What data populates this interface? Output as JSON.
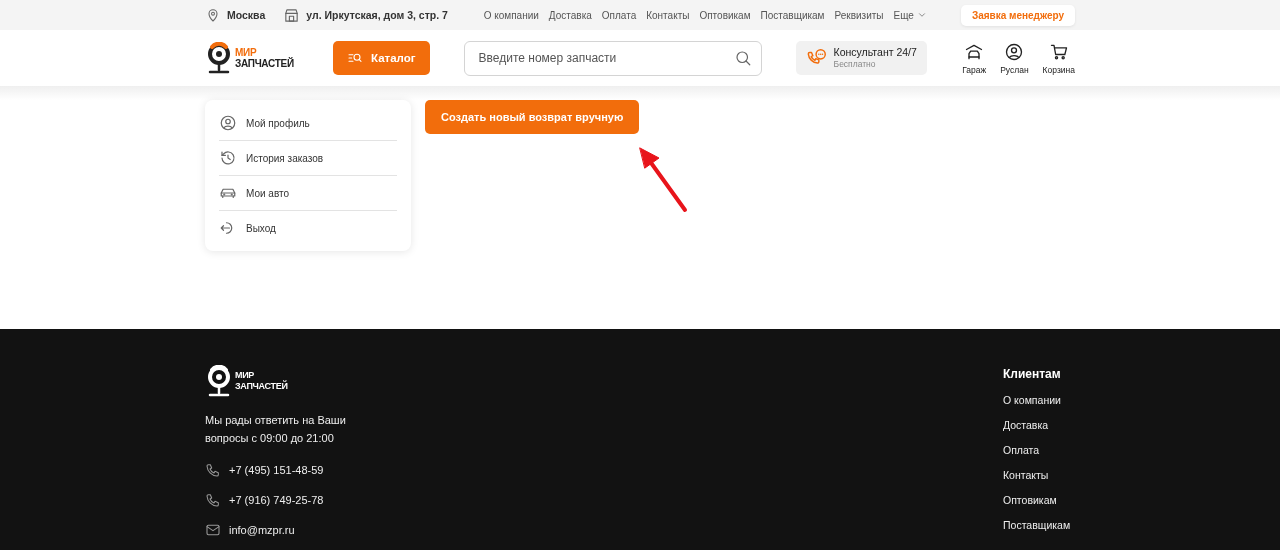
{
  "topbar": {
    "city": "Москва",
    "address": "ул. Иркутская, дом 3, стр. 7",
    "nav": [
      "О компании",
      "Доставка",
      "Оплата",
      "Контакты",
      "Оптовикам",
      "Поставщикам",
      "Реквизиты"
    ],
    "more": "Еще",
    "request_button": "Заявка менеджеру"
  },
  "header": {
    "logo": [
      "МИР",
      "ЗАПЧАСТЕЙ"
    ],
    "catalog_button": "Каталог",
    "search": {
      "placeholder": "Введите номер запчасти"
    },
    "consultant": {
      "title": "Консультант 24/7",
      "subtitle": "Бесплатно"
    },
    "actions": [
      {
        "kind": "garage",
        "label": "Гараж"
      },
      {
        "kind": "user",
        "label": "Руслан"
      },
      {
        "kind": "cart",
        "label": "Корзина"
      }
    ]
  },
  "sidebar": {
    "items": [
      {
        "kind": "profile",
        "label": "Мой профиль"
      },
      {
        "kind": "history",
        "label": "История заказов"
      },
      {
        "kind": "car",
        "label": "Мои авто"
      },
      {
        "kind": "logout",
        "label": "Выход"
      }
    ]
  },
  "create_button": "Создать новый возврат вручную",
  "footer": {
    "logo": [
      "МИР",
      "ЗАПЧАСТЕЙ"
    ],
    "text_lines": [
      "Мы рады ответить на Ваши",
      "вопросы с 09:00 до 21:00"
    ],
    "contacts": [
      {
        "kind": "phone",
        "text": "+7 (495) 151-48-59"
      },
      {
        "kind": "phone",
        "text": "+7 (916) 749-25-78"
      },
      {
        "kind": "email",
        "text": "info@mzpr.ru"
      }
    ],
    "clients": {
      "title": "Клиентам",
      "links": [
        "О компании",
        "Доставка",
        "Оплата",
        "Контакты",
        "Оптовикам",
        "Поставщикам"
      ]
    }
  }
}
